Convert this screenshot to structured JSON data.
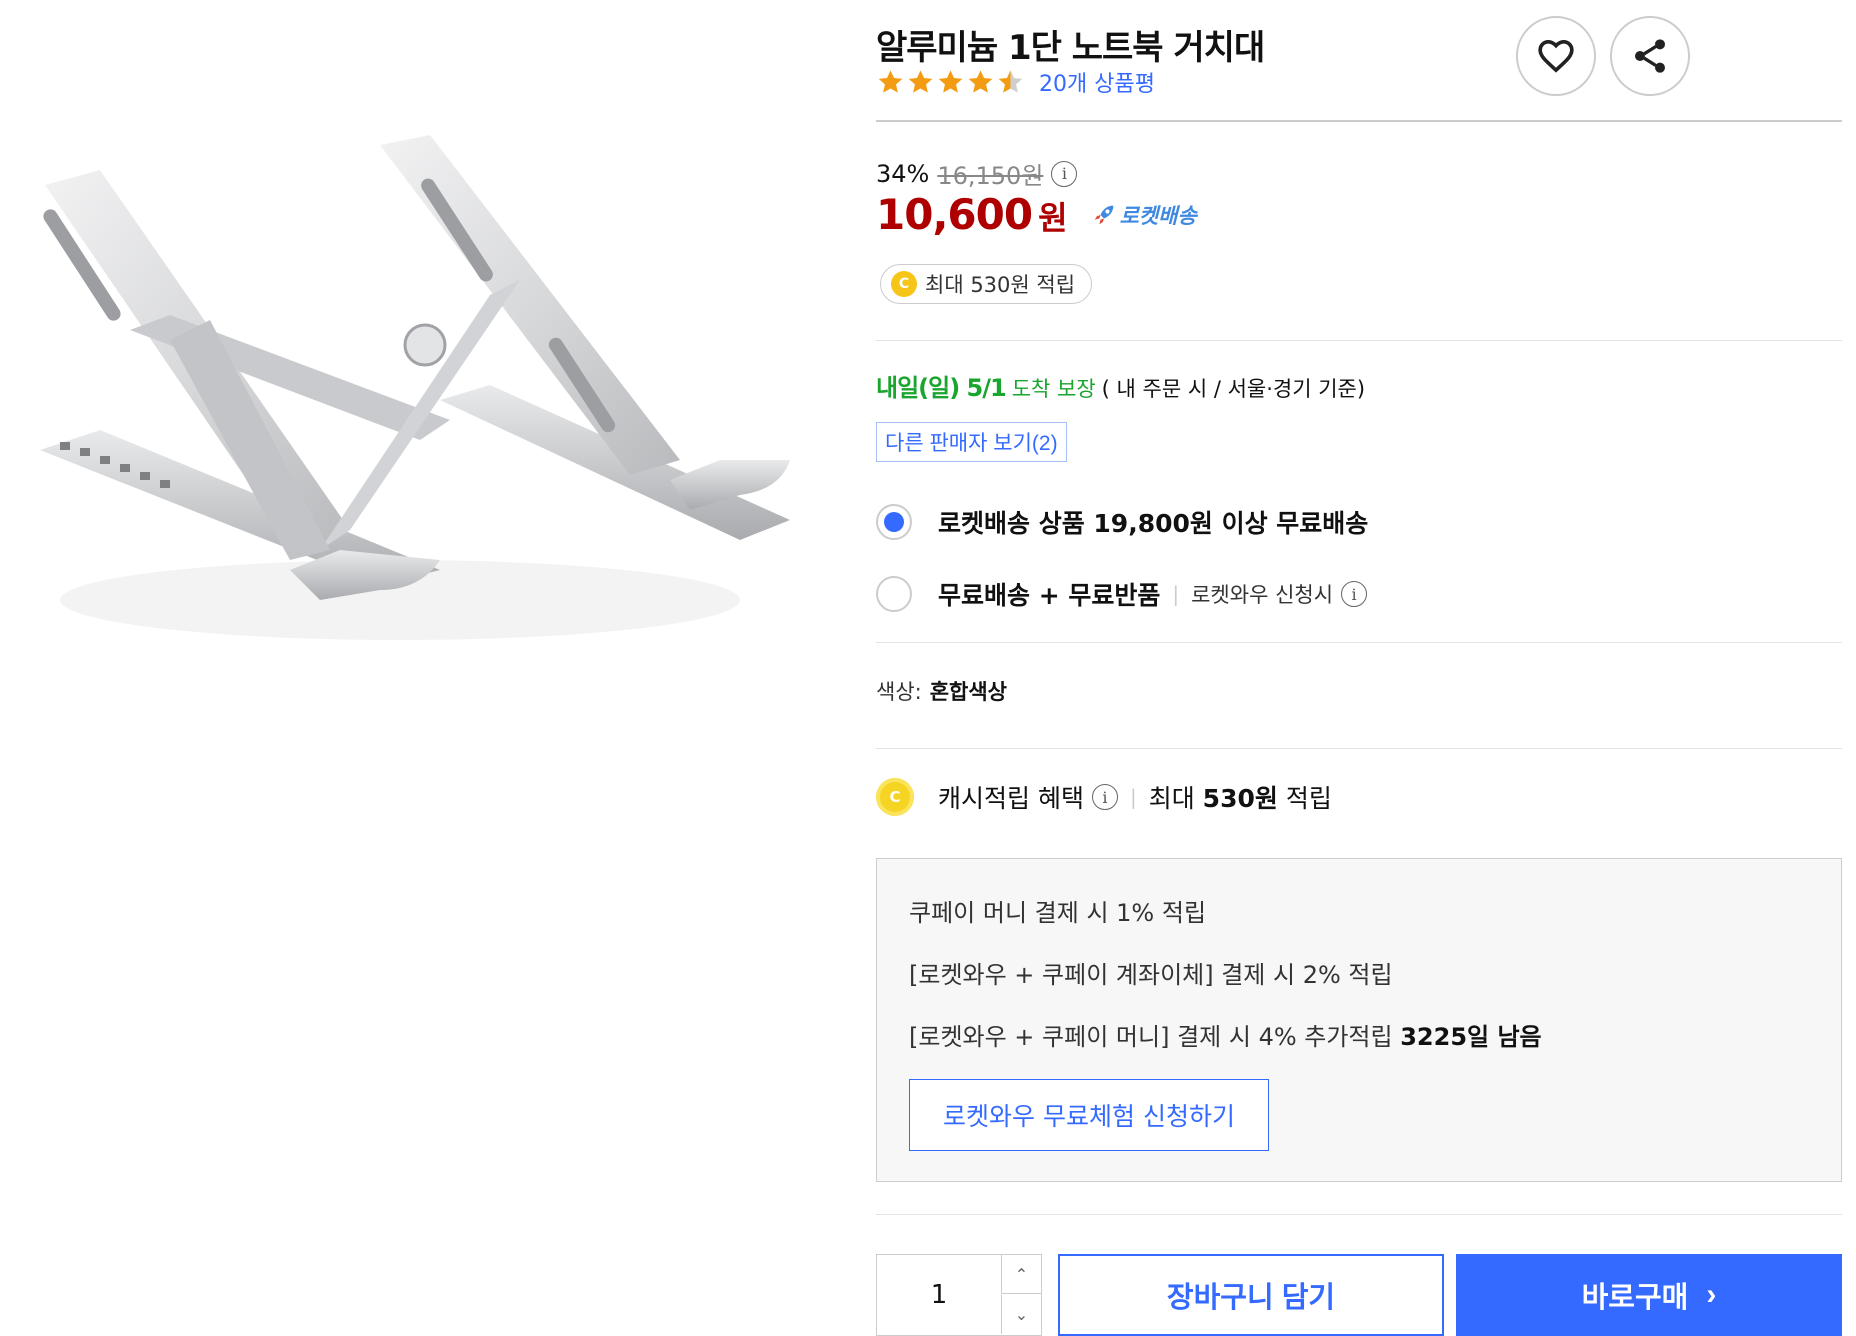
{
  "product": {
    "title": "알루미늄 1단 노트북 거치대",
    "rating_stars": 4.5,
    "review_count_text": "20개 상품평"
  },
  "icons": {
    "wishlist": "heart-icon",
    "share": "share-icon"
  },
  "price": {
    "discount": "34%",
    "original": "16,150원",
    "sale": "10,600",
    "currency": "원",
    "rocket_label": "로켓배송",
    "cash_chip": "최대 530원 적립",
    "coin_letter": "C"
  },
  "delivery": {
    "arrive": "내일(일) 5/1",
    "guarantee": "도착 보장",
    "note": "( 내 주문 시 / 서울·경기 기준)"
  },
  "other_sellers": "다른 판매자 보기(2)",
  "shipping_options": [
    {
      "label": "로켓배송 상품 19,800원 이상 무료배송",
      "sub": "",
      "selected": true
    },
    {
      "label": "무료배송 + 무료반품",
      "sub": "로켓와우 신청시",
      "selected": false
    }
  ],
  "color_option": {
    "label": "색상:",
    "value": "혼합색상"
  },
  "cashback": {
    "label": "캐시적립 혜택",
    "prefix": "최대",
    "amount": "530원",
    "suffix": "적립"
  },
  "benefits": {
    "line1": "쿠페이 머니 결제 시 1% 적립",
    "line2": "[로켓와우 + 쿠페이 계좌이체] 결제 시 2% 적립",
    "line3": "[로켓와우 + 쿠페이 머니] 결제 시 4% 추가적립",
    "line3_bold": "3225일 남음",
    "trial_button": "로켓와우 무료체험 신청하기"
  },
  "purchase": {
    "quantity": "1",
    "cart_button": "장바구니 담기",
    "buy_button": "바로구매"
  },
  "colors": {
    "accent_blue": "#346aff",
    "price_red": "#ae0000",
    "delivery_green": "#1aa52e",
    "star_orange": "#f39c12",
    "coin_yellow": "#f5c518"
  }
}
